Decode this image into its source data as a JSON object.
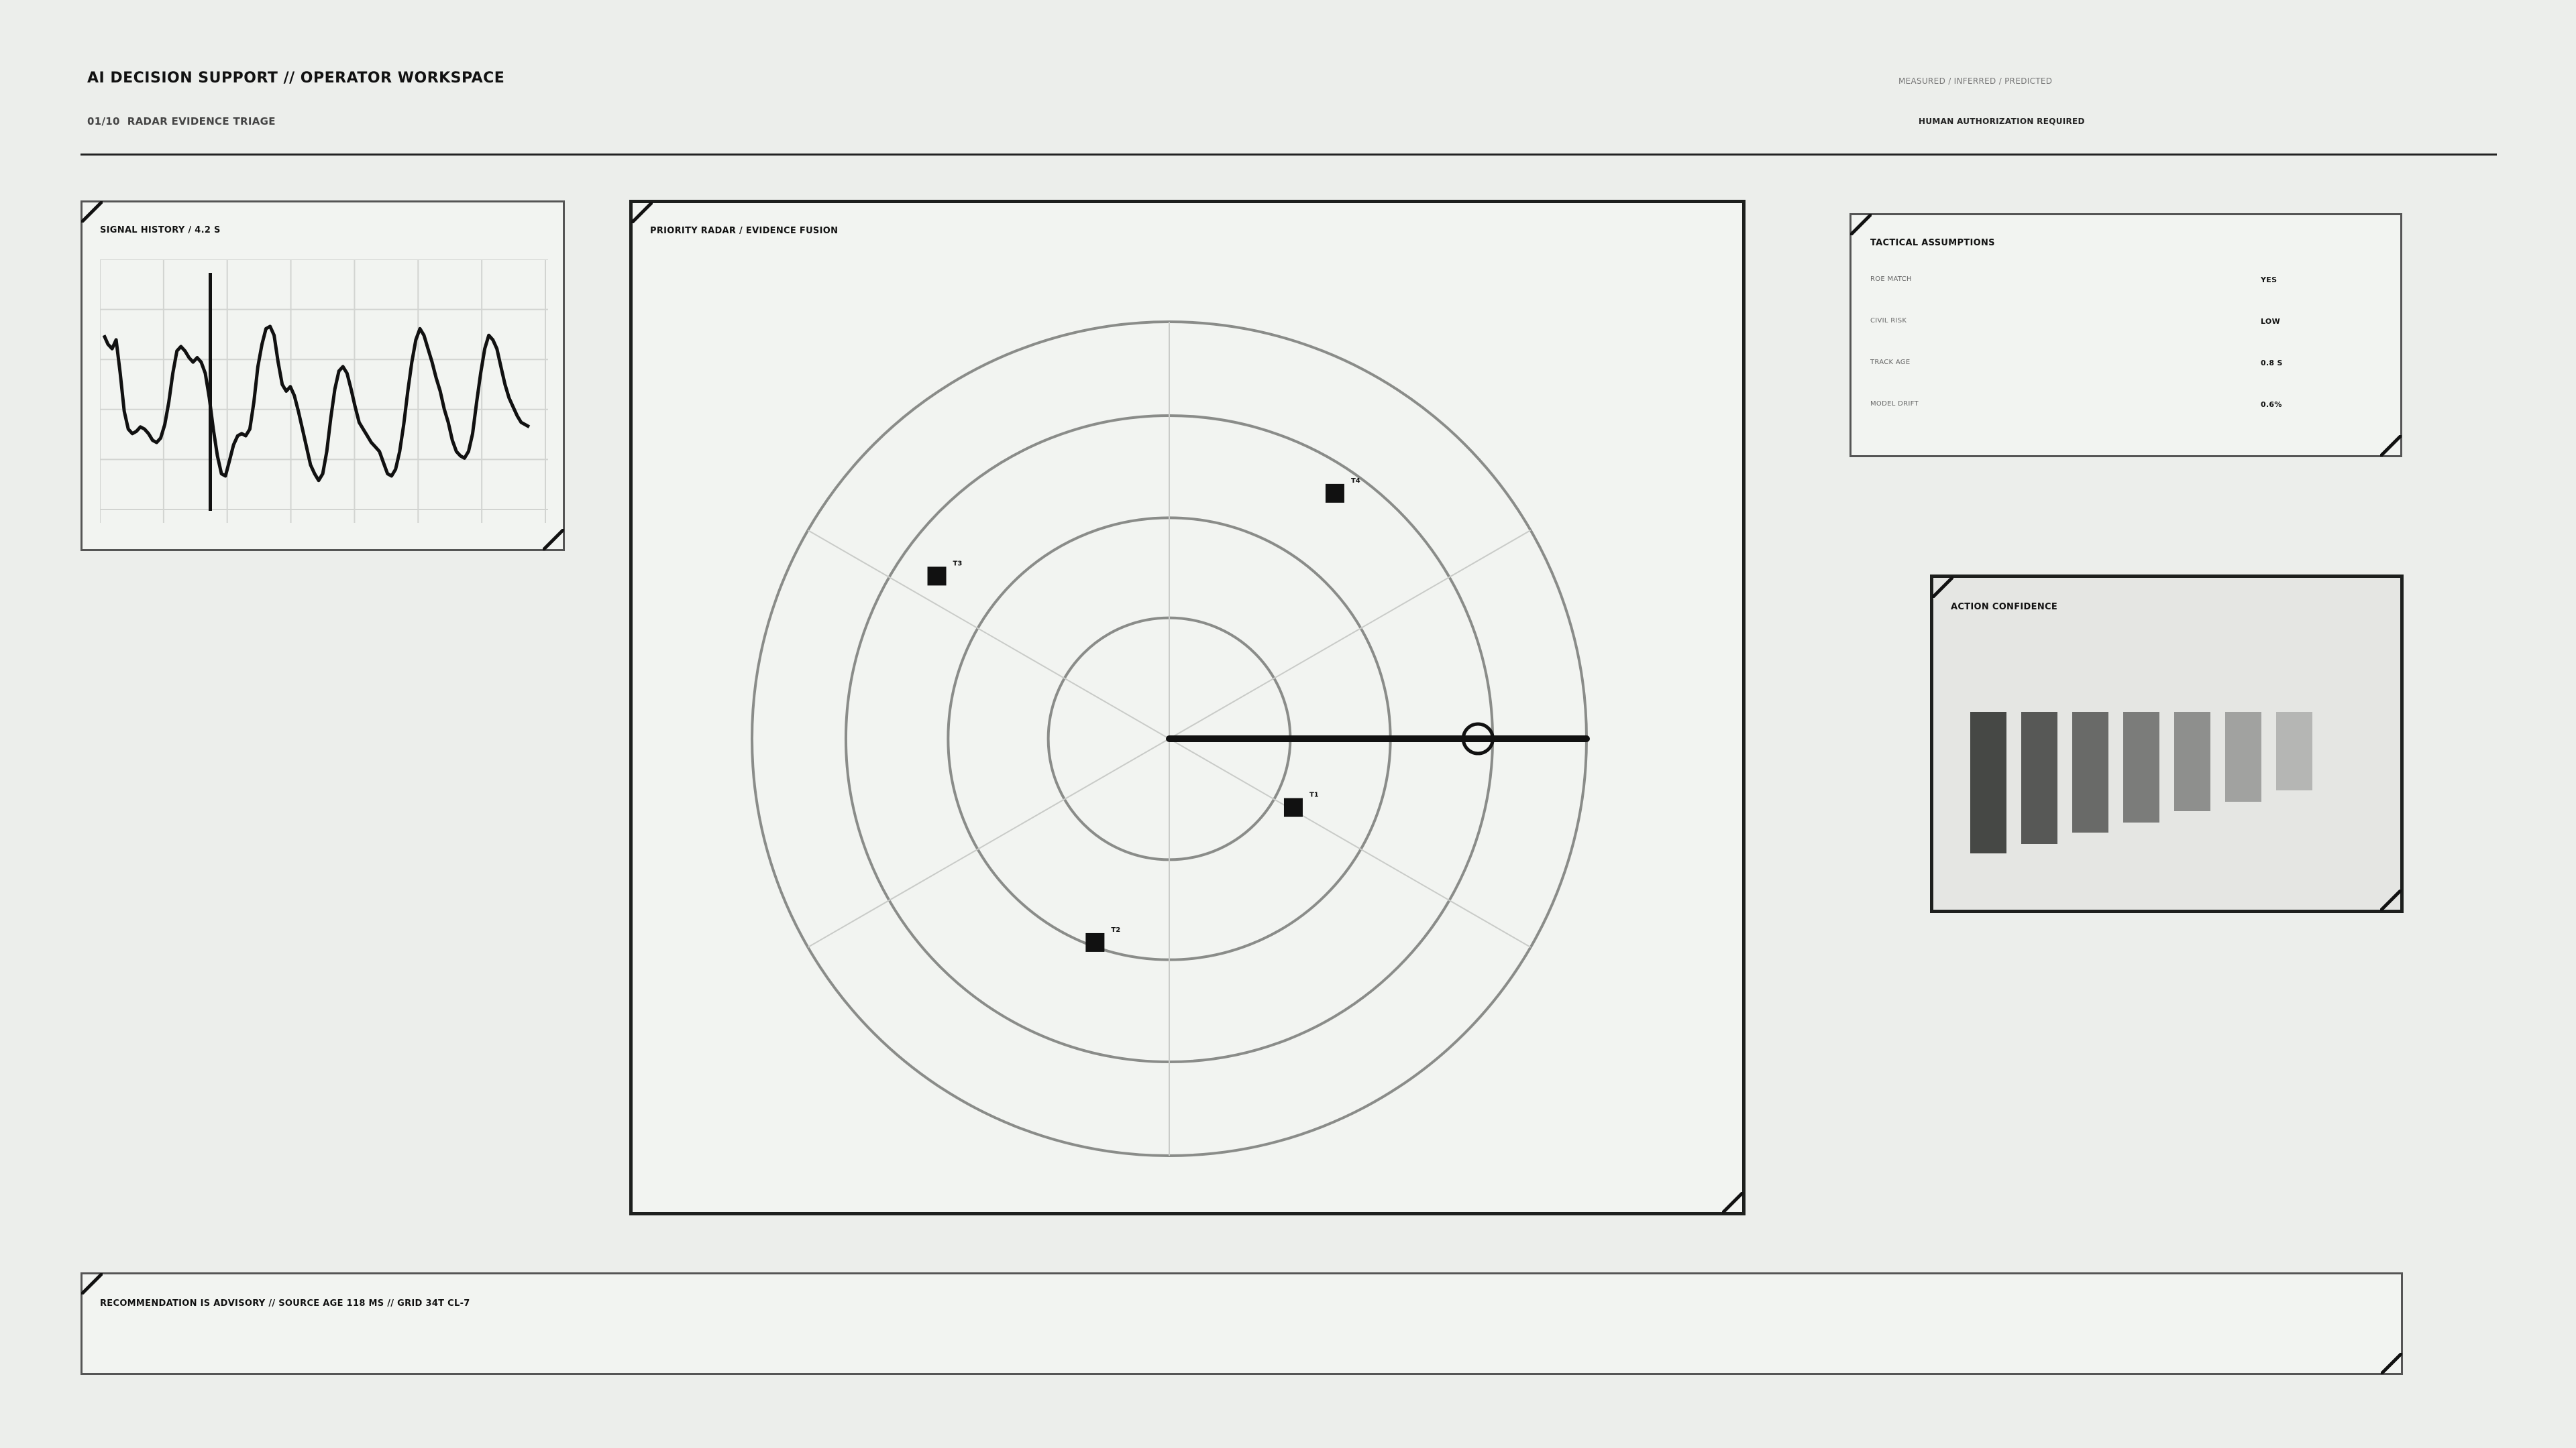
{
  "header": {
    "title": "AI DECISION SUPPORT // OPERATOR WORKSPACE",
    "subtitle_prefix": "01/10",
    "subtitle": "RADAR EVIDENCE TRIAGE",
    "legend": "MEASURED / INFERRED / PREDICTED",
    "authorization": "HUMAN AUTHORIZATION REQUIRED"
  },
  "signal_history": {
    "title": "SIGNAL HISTORY / 4.2 S",
    "samples": [
      0.72,
      0.68,
      0.66,
      0.7,
      0.55,
      0.38,
      0.3,
      0.28,
      0.29,
      0.31,
      0.3,
      0.28,
      0.25,
      0.24,
      0.26,
      0.32,
      0.42,
      0.55,
      0.65,
      0.67,
      0.65,
      0.62,
      0.6,
      0.62,
      0.6,
      0.55,
      0.44,
      0.3,
      0.18,
      0.1,
      0.09,
      0.16,
      0.23,
      0.27,
      0.28,
      0.27,
      0.3,
      0.42,
      0.58,
      0.68,
      0.75,
      0.76,
      0.72,
      0.6,
      0.5,
      0.47,
      0.49,
      0.45,
      0.38,
      0.3,
      0.22,
      0.14,
      0.1,
      0.07,
      0.1,
      0.2,
      0.35,
      0.48,
      0.56,
      0.58,
      0.55,
      0.48,
      0.4,
      0.33,
      0.3,
      0.27,
      0.24,
      0.22,
      0.2,
      0.15,
      0.1,
      0.09,
      0.12,
      0.2,
      0.32,
      0.47,
      0.6,
      0.7,
      0.75,
      0.72,
      0.66,
      0.6,
      0.53,
      0.47,
      0.39,
      0.33,
      0.25,
      0.2,
      0.18,
      0.17,
      0.2,
      0.28,
      0.42,
      0.55,
      0.66,
      0.72,
      0.7,
      0.66,
      0.58,
      0.5,
      0.44,
      0.4,
      0.36,
      0.33,
      0.32,
      0.31
    ],
    "marker_position": 0.25
  },
  "radar": {
    "title": "PRIORITY RADAR / EVIDENCE FUSION",
    "targets": [
      {
        "id": "T1",
        "range": 0.34,
        "bearing_deg": -29
      },
      {
        "id": "T2",
        "range": 0.52,
        "bearing_deg": -110
      },
      {
        "id": "T3",
        "range": 0.68,
        "bearing_deg": 145
      },
      {
        "id": "T4",
        "range": 0.71,
        "bearing_deg": 56
      }
    ],
    "sweep_bearing_deg": 0,
    "selected_range": 0.74
  },
  "tactical_assumptions": {
    "title": "TACTICAL ASSUMPTIONS",
    "rows": [
      {
        "label": "ROE MATCH",
        "value": "YES"
      },
      {
        "label": "CIVIL RISK",
        "value": "LOW"
      },
      {
        "label": "TRACK AGE",
        "value": "0.8 S"
      },
      {
        "label": "MODEL DRIFT",
        "value": "0.6%"
      }
    ]
  },
  "action_confidence": {
    "title": "ACTION CONFIDENCE",
    "levels": [
      0.87,
      0.81,
      0.74,
      0.68,
      0.61,
      0.55,
      0.48
    ],
    "colors": [
      "#464845",
      "#575856",
      "#696a68",
      "#7b7c7a",
      "#8e8f8d",
      "#a1a2a0",
      "#b5b6b4"
    ]
  },
  "footer": {
    "text": "RECOMMENDATION IS ADVISORY // SOURCE AGE 118 MS // GRID 34T CL-7"
  }
}
